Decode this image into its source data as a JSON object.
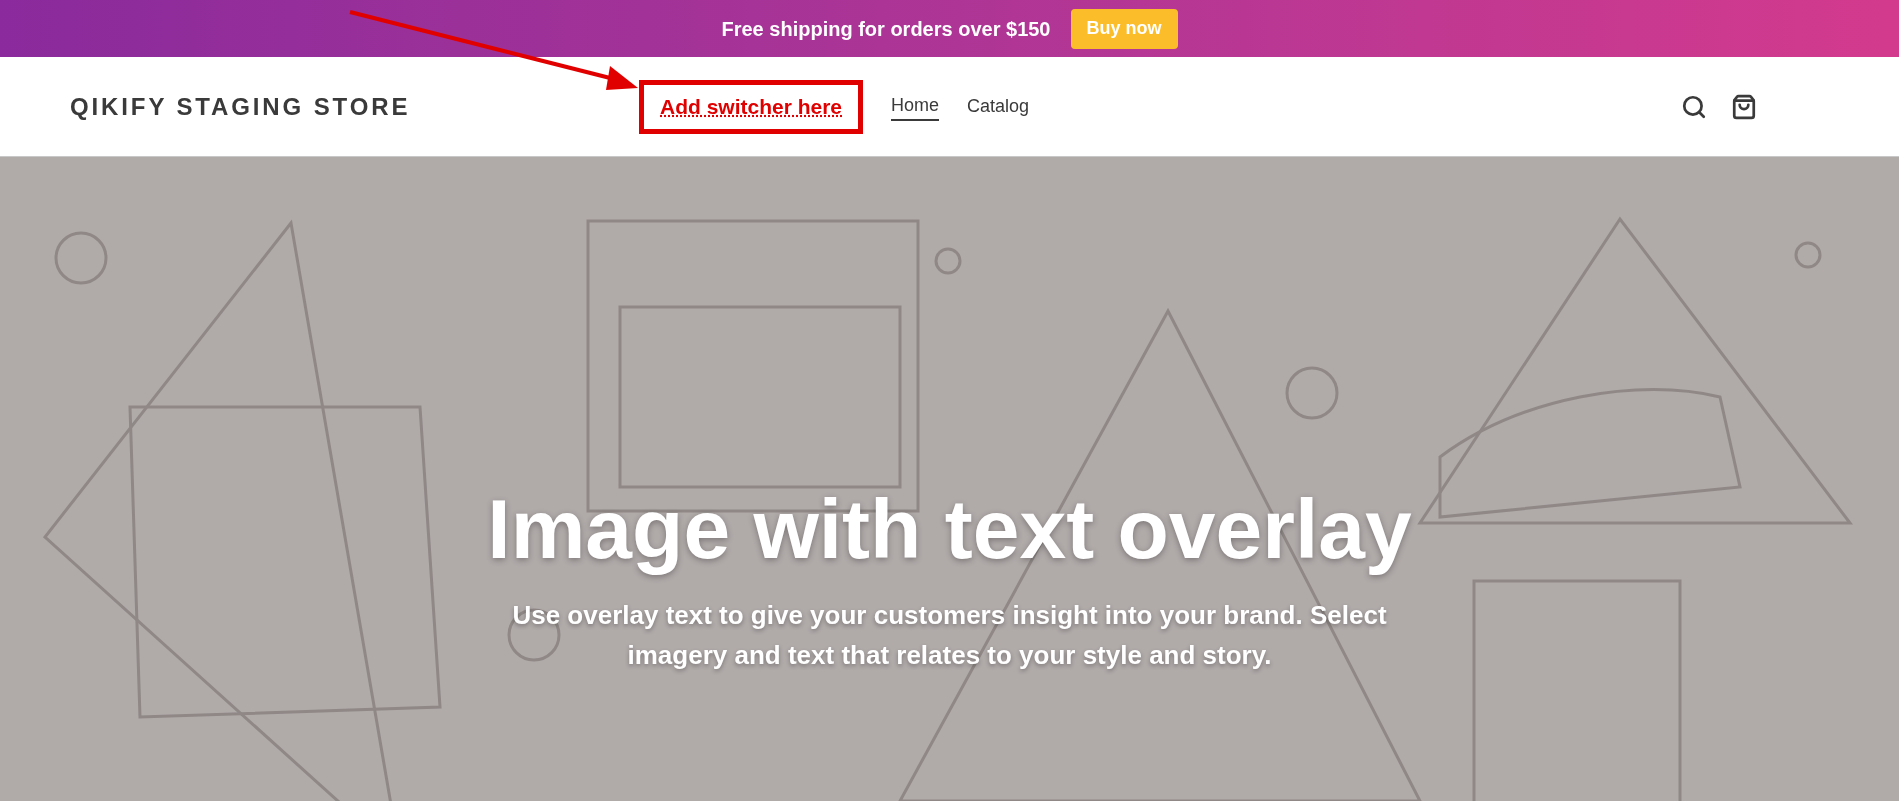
{
  "announcement": {
    "text": "Free shipping for orders over $150",
    "button": "Buy now"
  },
  "header": {
    "logo": "QIKIFY STAGING STORE",
    "nav": [
      {
        "label": "Add switcher here",
        "kind": "annotation",
        "selected": false
      },
      {
        "label": "Home",
        "kind": "link",
        "selected": true
      },
      {
        "label": "Catalog",
        "kind": "link",
        "selected": false
      }
    ]
  },
  "hero": {
    "kind": "picture",
    "title": "Image with text overlay",
    "subtitle": "Use overlay text to give your customers insight into your brand. Select imagery and text that relates to your style and story."
  }
}
